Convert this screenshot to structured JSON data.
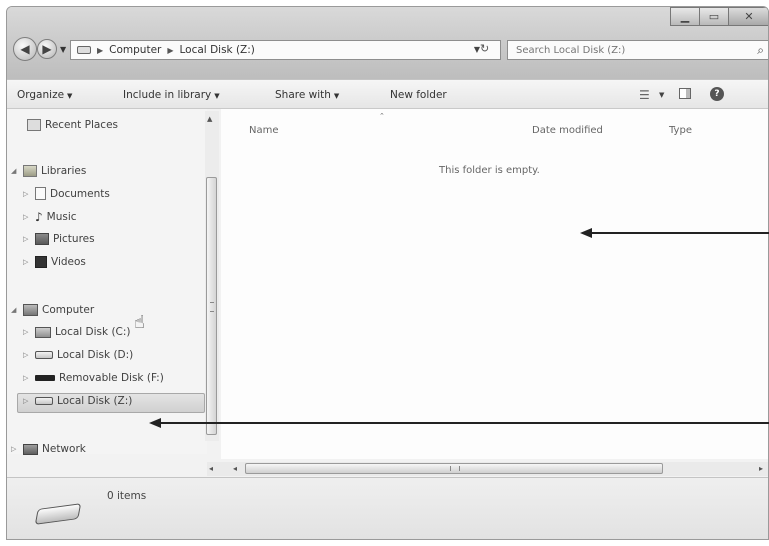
{
  "address": {
    "segments": [
      "Computer",
      "Local Disk (Z:)"
    ]
  },
  "search": {
    "placeholder": "Search Local Disk (Z:)"
  },
  "toolbar": {
    "organize": "Organize",
    "include_in_library": "Include in library",
    "share_with": "Share with",
    "new_folder": "New folder"
  },
  "sidebar": {
    "recent_places": "Recent Places",
    "libraries": "Libraries",
    "documents": "Documents",
    "music": "Music",
    "pictures": "Pictures",
    "videos": "Videos",
    "computer": "Computer",
    "local_c": "Local Disk (C:)",
    "local_d": "Local Disk (D:)",
    "removable_f": "Removable Disk (F:)",
    "local_z": "Local Disk (Z:)",
    "network": "Network"
  },
  "columns": {
    "name": "Name",
    "date_modified": "Date modified",
    "type": "Type"
  },
  "content": {
    "empty_message": "This folder is empty."
  },
  "status": {
    "item_count": "0 items"
  }
}
